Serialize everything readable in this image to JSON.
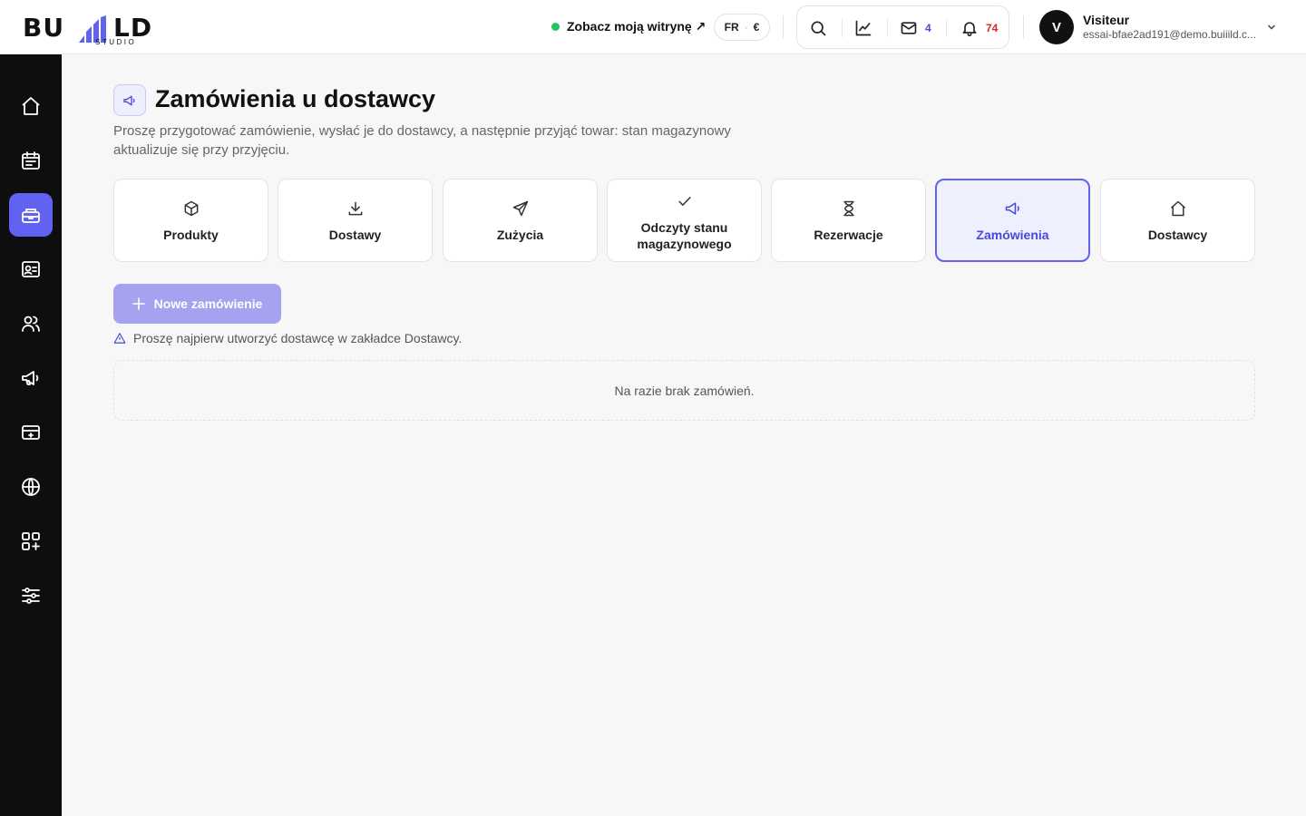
{
  "brand": {
    "logo_text_left": "BU",
    "logo_text_right": "LD",
    "logo_sub": "STUDIO"
  },
  "header": {
    "site_link": "Zobacz moją witrynę ↗",
    "locale_lang": "FR",
    "locale_sep": "·",
    "locale_currency": "€",
    "mail_count": "4",
    "notif_count": "74",
    "user": {
      "initial": "V",
      "name": "Visiteur",
      "email": "essai-bfae2ad191@demo.buiiild.c..."
    }
  },
  "sidebar": {
    "items": [
      {
        "icon": "home-icon",
        "active": false
      },
      {
        "icon": "calendar-icon",
        "active": false
      },
      {
        "icon": "inventory-icon",
        "active": true
      },
      {
        "icon": "contact-card-icon",
        "active": false
      },
      {
        "icon": "users-icon",
        "active": false
      },
      {
        "icon": "megaphone-icon",
        "active": false
      },
      {
        "icon": "payment-card-icon",
        "active": false
      },
      {
        "icon": "globe-icon",
        "active": false
      },
      {
        "icon": "apps-add-icon",
        "active": false
      },
      {
        "icon": "sliders-icon",
        "active": false
      }
    ]
  },
  "page": {
    "title": "Zamówienia u dostawcy",
    "description": "Proszę przygotować zamówienie, wysłać je do dostawcy, a następnie przyjąć towar: stan magazynowy aktualizuje się przy przyjęciu."
  },
  "tabs": [
    {
      "label": "Produkty",
      "icon": "box-icon"
    },
    {
      "label": "Dostawy",
      "icon": "download-icon"
    },
    {
      "label": "Zużycia",
      "icon": "send-icon"
    },
    {
      "label_line1": "Odczyty stanu",
      "label_line2": "magazynowego",
      "icon": "check-icon"
    },
    {
      "label": "Rezerwacje",
      "icon": "hourglass-icon"
    },
    {
      "label": "Zamówienia",
      "icon": "megaphone-icon",
      "active": true
    },
    {
      "label": "Dostawcy",
      "icon": "home-icon"
    }
  ],
  "actions": {
    "new_order_label": "Nowe zamówienie"
  },
  "warning": "Proszę najpierw utworzyć dostawcę w zakładce Dostawcy.",
  "empty_state": "Na razie brak zamówień.",
  "colors": {
    "accent": "#6262f0",
    "mail_count": "#4848d8",
    "notif_count": "#dc2626",
    "status_online": "#22c55e",
    "sidebar_bg": "#0e0e10"
  }
}
